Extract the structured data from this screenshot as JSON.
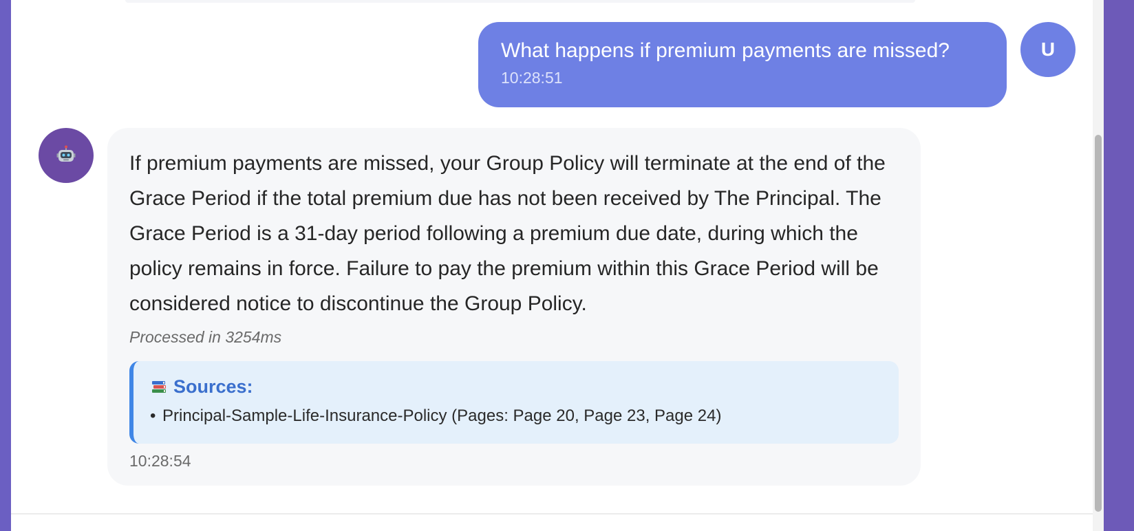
{
  "user_message": {
    "avatar_initial": "U",
    "text": "What happens if premium payments are missed?",
    "time": "10:28:51"
  },
  "bot_message": {
    "avatar_icon": "robot-icon",
    "text": "If premium payments are missed, your Group Policy will terminate at the end of the Grace Period if the total premium due has not been received by The Principal. The Grace Period is a 31-day period following a premium due date, during which the policy remains in force. Failure to pay the premium within this Grace Period will be considered notice to discontinue the Group Policy.",
    "processed": "Processed in 3254ms",
    "sources": {
      "icon": "books-icon",
      "title": "Sources:",
      "items": [
        "Principal-Sample-Life-Insurance-Policy (Pages: Page 20, Page 23, Page 24)"
      ]
    },
    "time": "10:28:54"
  },
  "colors": {
    "user_bubble": "#6e80e4",
    "bot_avatar": "#6b4aa4",
    "sources_accent": "#3f86e6",
    "sources_title": "#3a6fcd"
  }
}
